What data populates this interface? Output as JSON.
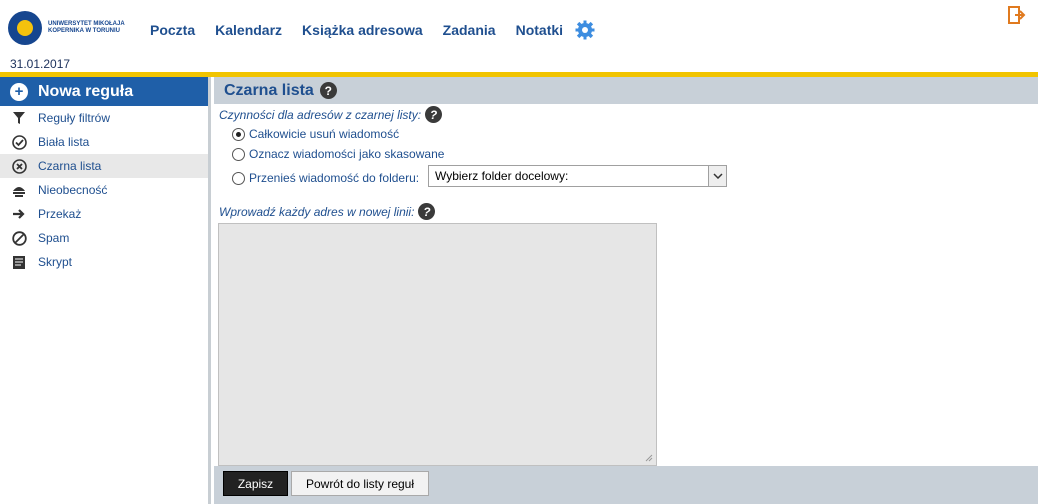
{
  "header": {
    "logo_text": "UNIWERSYTET MIKOŁAJA KOPERNIKA W TORUNIU",
    "nav": [
      "Poczta",
      "Kalendarz",
      "Książka adresowa",
      "Zadania",
      "Notatki"
    ],
    "date": "31.01.2017",
    "settings_icon": "gear-icon",
    "logout_icon": "logout-icon",
    "accent": "#f1c400"
  },
  "sidebar": {
    "new_rule": "Nowa reguła",
    "items": [
      {
        "label": "Reguły filtrów",
        "icon": "filter-icon",
        "active": false
      },
      {
        "label": "Biała lista",
        "icon": "check-circle-icon",
        "active": false
      },
      {
        "label": "Czarna lista",
        "icon": "x-circle-icon",
        "active": true
      },
      {
        "label": "Nieobecność",
        "icon": "vacation-icon",
        "active": false
      },
      {
        "label": "Przekaż",
        "icon": "forward-arrow-icon",
        "active": false
      },
      {
        "label": "Spam",
        "icon": "no-sign-icon",
        "active": false
      },
      {
        "label": "Skrypt",
        "icon": "script-icon",
        "active": false
      }
    ]
  },
  "main": {
    "title": "Czarna lista",
    "actions_label": "Czynności dla adresów z czarnej listy:",
    "options": [
      {
        "label": "Całkowicie usuń wiadomość",
        "selected": true
      },
      {
        "label": "Oznacz wiadomości jako skasowane",
        "selected": false
      },
      {
        "label": "Przenieś wiadomość do folderu:",
        "selected": false
      }
    ],
    "folder_select": "Wybierz folder docelowy:",
    "addresses_label": "Wprowadź każdy adres w nowej linii:",
    "addresses_value": "",
    "save_button": "Zapisz",
    "back_button": "Powrót do listy reguł"
  }
}
